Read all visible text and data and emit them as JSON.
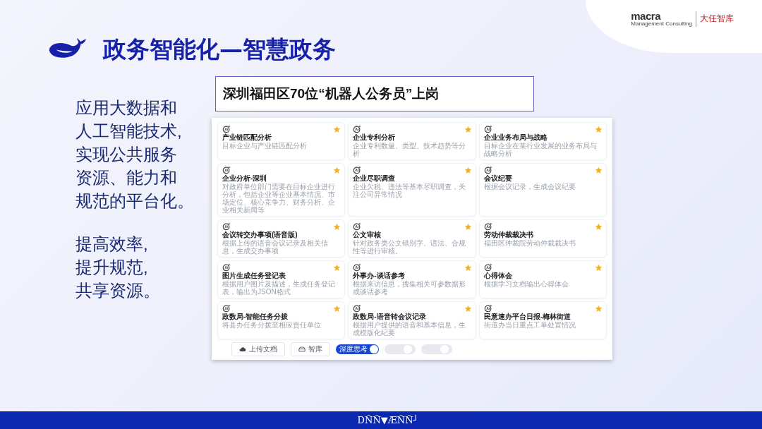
{
  "brand": {
    "name": "macra",
    "subtitle": "Management Consulting",
    "cn_name": "大任智库"
  },
  "title": "政务智能化—智慧政务",
  "left_paragraphs": [
    {
      "lines": [
        "应用大数据和",
        "人工智能技术,",
        "实现公共服务",
        "资源、能力和",
        "规范的平台化。"
      ]
    },
    {
      "lines": [
        "提高效率,",
        "提升规范,",
        "共享资源。"
      ]
    }
  ],
  "caption": "深圳福田区70位“机器人公务员”上岗",
  "apps": [
    {
      "title": "产业链匹配分析",
      "desc": "目标企业与产业链匹配分析",
      "starred": true
    },
    {
      "title": "企业专利分析",
      "desc": "企业专利数量、类型、技术趋势等分析",
      "starred": true
    },
    {
      "title": "企业业务布局与战略",
      "desc": "目标企业在某行业发展的业务布局与战略分析",
      "starred": true
    },
    {
      "title": "企业分析-深圳",
      "desc": "对政府单位部门需要在目标企业进行分析，包括企业等企业基本情况、市场定位、核心竞争力、财务分析、企业相关新闻等",
      "starred": true
    },
    {
      "title": "企业尽职调查",
      "desc": "企业欠税、违法等基本尽职调查，关注公司异常情况",
      "starred": true
    },
    {
      "title": "会议纪要",
      "desc": "根据会议记录，生成会议纪要",
      "starred": true
    },
    {
      "title": "会议转交办事项(语音版)",
      "desc": "根据上传的语音会议记录及相关信息，生成交办事项",
      "starred": true
    },
    {
      "title": "公文审核",
      "desc": "针对政务类公文错别字、语法、合规性等进行审核。",
      "starred": true
    },
    {
      "title": "劳动仲裁裁决书",
      "desc": "福田区仲裁院劳动仲裁裁决书",
      "starred": true
    },
    {
      "title": "图片生成任务登记表",
      "desc": "根据用户图片及描述，生成任务登记表，输出为JSON格式",
      "starred": true
    },
    {
      "title": "外事办-谈话参考",
      "desc": "根据来访信息，搜集相关可参数据形成谈话参考",
      "starred": true
    },
    {
      "title": "心得体会",
      "desc": "根据学习文档输出心得体会",
      "starred": true
    },
    {
      "title": "政数局-智能任务分拨",
      "desc": "将县办任务分拨至相应责任单位",
      "starred": true
    },
    {
      "title": "政数局-语音转会议记录",
      "desc": "根据用户提供的语音和基本信息，生成模版化纪要",
      "starred": true
    },
    {
      "title": "民意速办平台日报-梅林街道",
      "desc": "街道办当日重点工单处置情况",
      "starred": true
    }
  ],
  "buttons": [
    {
      "kind": "upload",
      "label": "上传文档"
    },
    {
      "kind": "library",
      "label": "智库"
    }
  ],
  "toggles": [
    {
      "label": "深度思考",
      "on": true
    },
    {
      "on": false
    },
    {
      "on": false
    }
  ],
  "footer": "DÑÑ▼ÆÑÑ┘"
}
